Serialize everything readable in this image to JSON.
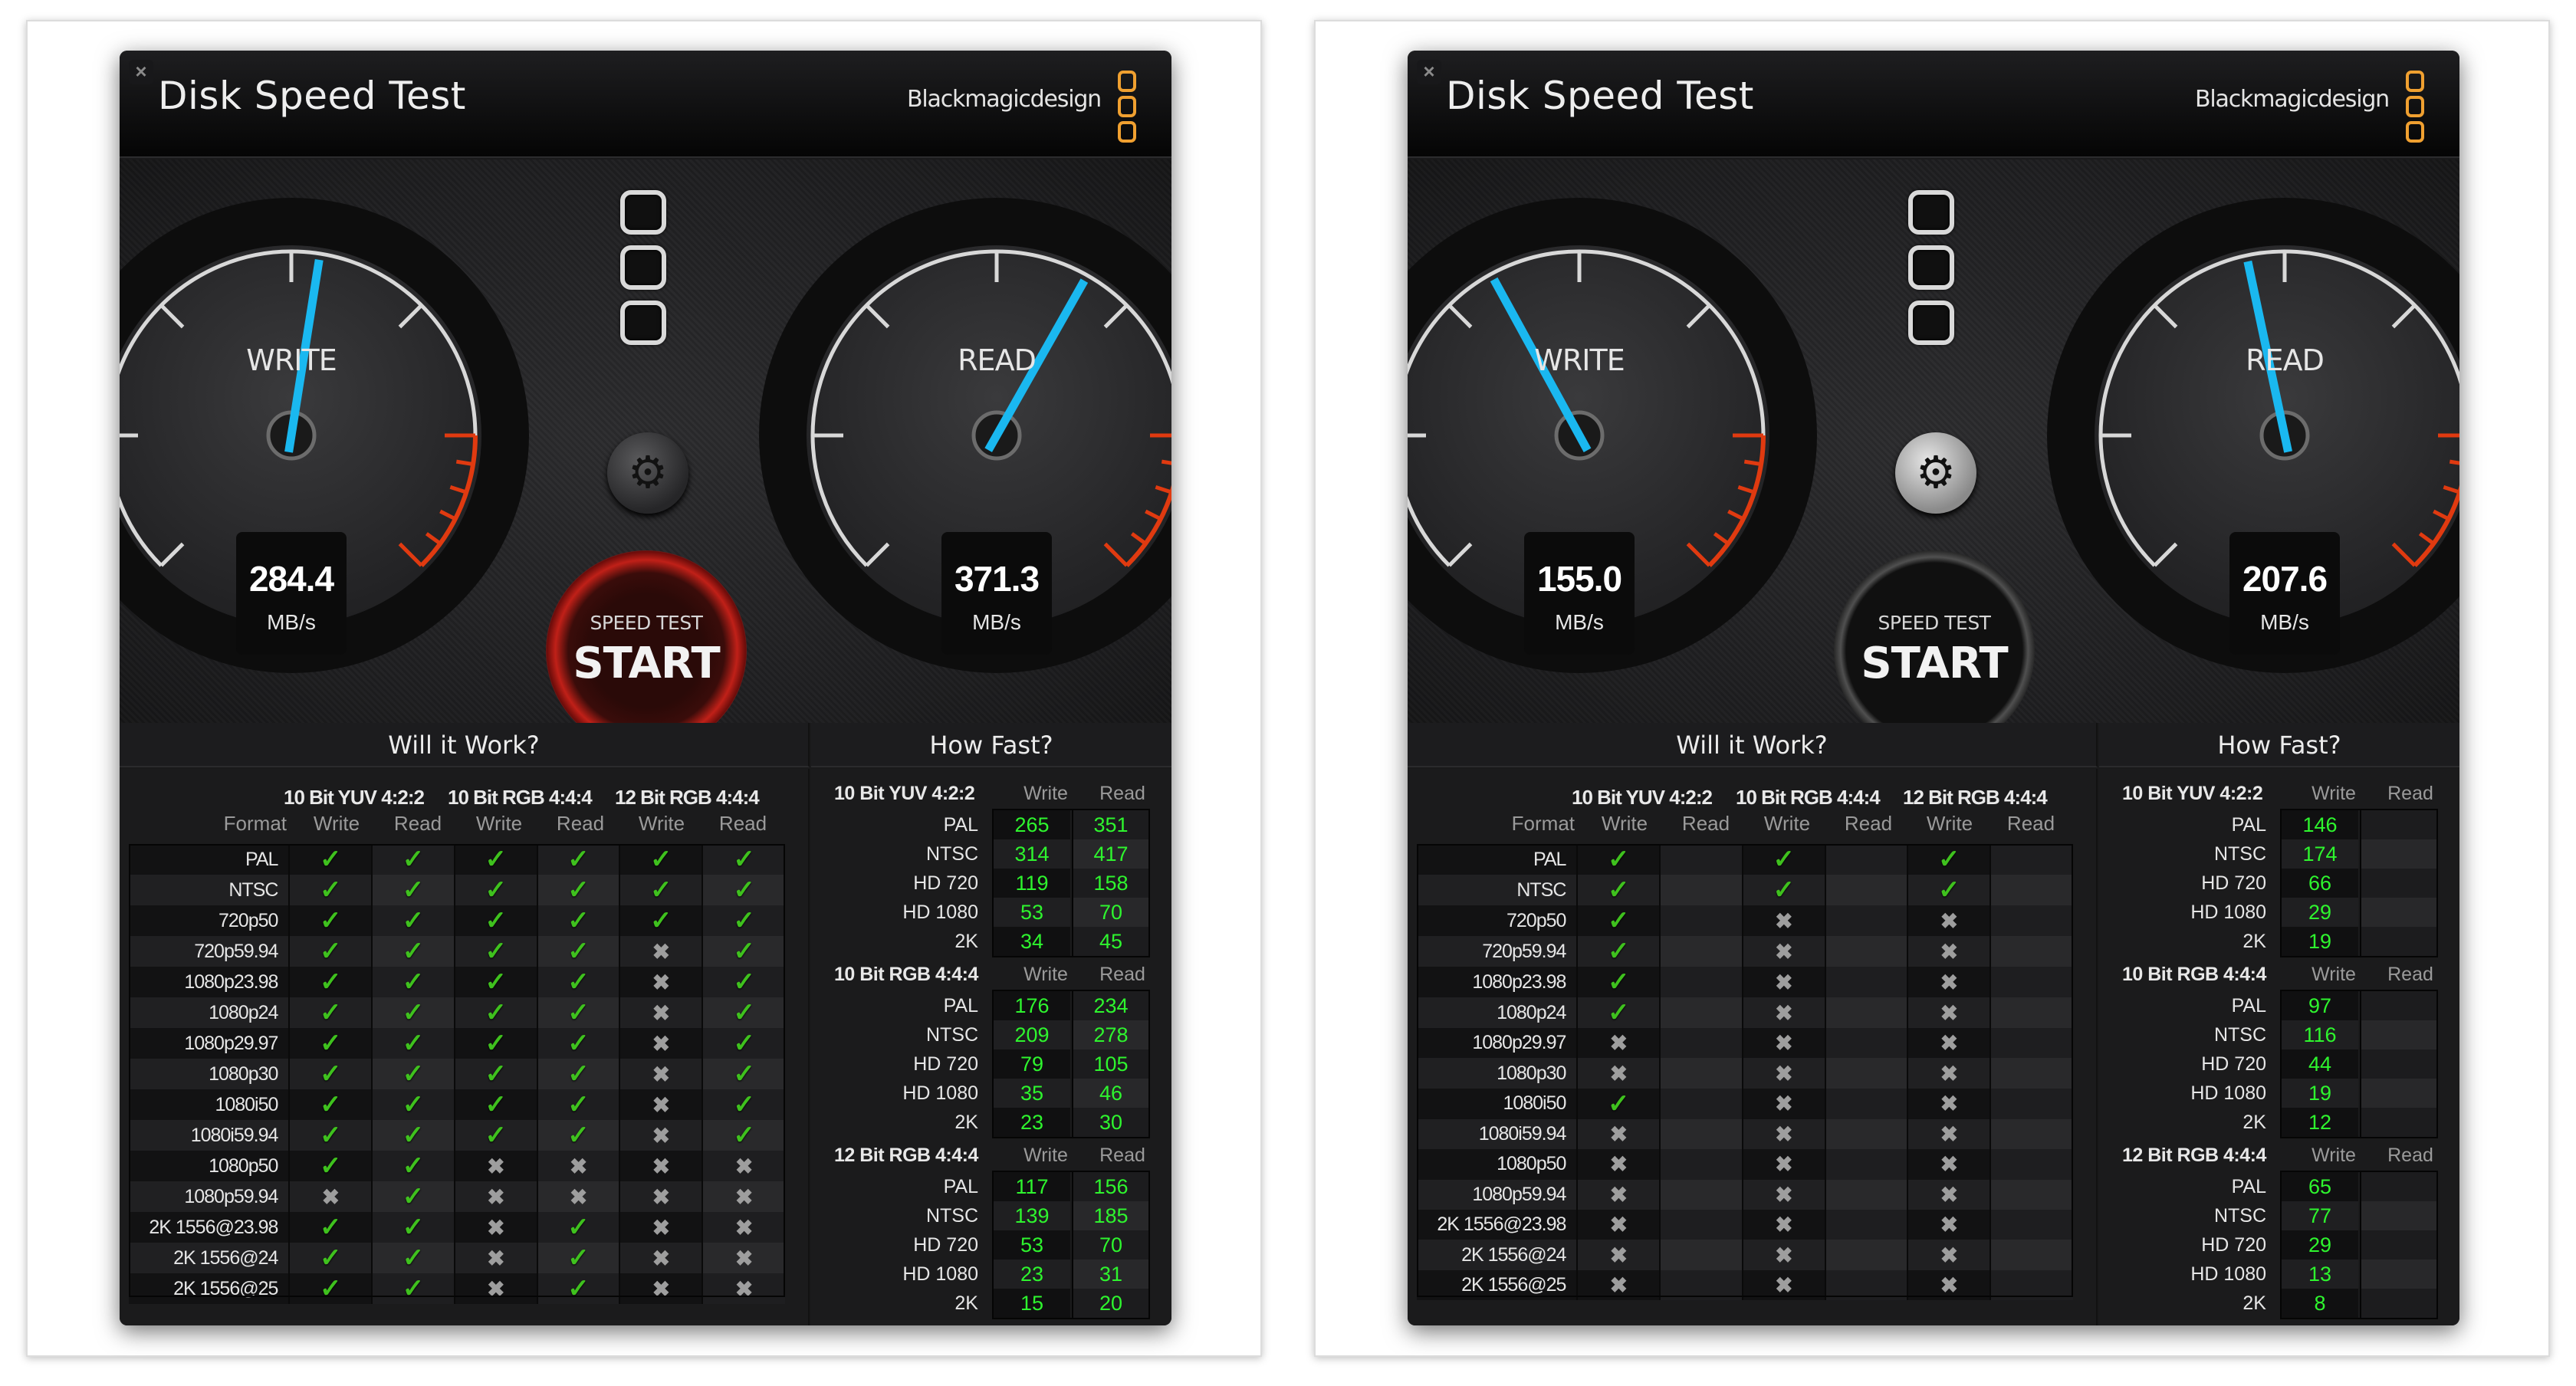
{
  "panels": [
    {
      "title": "Disk Speed Test",
      "brand": "Blackmagicdesign",
      "close_icon": "×",
      "gear_icon": "⚙",
      "active_gauge": "write",
      "write": {
        "label": "WRITE",
        "value": "284.4",
        "unit": "MB/s"
      },
      "read": {
        "label": "READ",
        "value": "371.3",
        "unit": "MB/s"
      },
      "start": {
        "small": "SPEED TEST",
        "big": "START"
      },
      "will_it_work": {
        "title": "Will it Work?",
        "groups": [
          "10 Bit YUV 4:2:2",
          "10 Bit RGB 4:4:4",
          "12 Bit RGB 4:4:4"
        ],
        "format_header": "Format",
        "write_header": "Write",
        "read_header": "Read",
        "rows": [
          {
            "format": "PAL",
            "cells": [
              "ok",
              "ok",
              "ok",
              "ok",
              "ok",
              "ok"
            ]
          },
          {
            "format": "NTSC",
            "cells": [
              "ok",
              "ok",
              "ok",
              "ok",
              "ok",
              "ok"
            ]
          },
          {
            "format": "720p50",
            "cells": [
              "ok",
              "ok",
              "ok",
              "ok",
              "ok",
              "ok"
            ]
          },
          {
            "format": "720p59.94",
            "cells": [
              "ok",
              "ok",
              "ok",
              "ok",
              "no",
              "ok"
            ]
          },
          {
            "format": "1080p23.98",
            "cells": [
              "ok",
              "ok",
              "ok",
              "ok",
              "no",
              "ok"
            ]
          },
          {
            "format": "1080p24",
            "cells": [
              "ok",
              "ok",
              "ok",
              "ok",
              "no",
              "ok"
            ]
          },
          {
            "format": "1080p29.97",
            "cells": [
              "ok",
              "ok",
              "ok",
              "ok",
              "no",
              "ok"
            ]
          },
          {
            "format": "1080p30",
            "cells": [
              "ok",
              "ok",
              "ok",
              "ok",
              "no",
              "ok"
            ]
          },
          {
            "format": "1080i50",
            "cells": [
              "ok",
              "ok",
              "ok",
              "ok",
              "no",
              "ok"
            ]
          },
          {
            "format": "1080i59.94",
            "cells": [
              "ok",
              "ok",
              "ok",
              "ok",
              "no",
              "ok"
            ]
          },
          {
            "format": "1080p50",
            "cells": [
              "ok",
              "ok",
              "no",
              "no",
              "no",
              "no"
            ]
          },
          {
            "format": "1080p59.94",
            "cells": [
              "no",
              "ok",
              "no",
              "no",
              "no",
              "no"
            ]
          },
          {
            "format": "2K 1556@23.98",
            "cells": [
              "ok",
              "ok",
              "no",
              "ok",
              "no",
              "no"
            ]
          },
          {
            "format": "2K 1556@24",
            "cells": [
              "ok",
              "ok",
              "no",
              "ok",
              "no",
              "no"
            ]
          },
          {
            "format": "2K 1556@25",
            "cells": [
              "ok",
              "ok",
              "no",
              "ok",
              "no",
              "no"
            ]
          }
        ]
      },
      "how_fast": {
        "title": "How Fast?",
        "write_header": "Write",
        "read_header": "Read",
        "groups": [
          {
            "name": "10 Bit YUV 4:2:2",
            "rows": [
              {
                "label": "PAL",
                "write": "265",
                "read": "351"
              },
              {
                "label": "NTSC",
                "write": "314",
                "read": "417"
              },
              {
                "label": "HD 720",
                "write": "119",
                "read": "158"
              },
              {
                "label": "HD 1080",
                "write": "53",
                "read": "70"
              },
              {
                "label": "2K",
                "write": "34",
                "read": "45"
              }
            ]
          },
          {
            "name": "10 Bit RGB 4:4:4",
            "rows": [
              {
                "label": "PAL",
                "write": "176",
                "read": "234"
              },
              {
                "label": "NTSC",
                "write": "209",
                "read": "278"
              },
              {
                "label": "HD 720",
                "write": "79",
                "read": "105"
              },
              {
                "label": "HD 1080",
                "write": "35",
                "read": "46"
              },
              {
                "label": "2K",
                "write": "23",
                "read": "30"
              }
            ]
          },
          {
            "name": "12 Bit RGB 4:4:4",
            "rows": [
              {
                "label": "PAL",
                "write": "117",
                "read": "156"
              },
              {
                "label": "NTSC",
                "write": "139",
                "read": "185"
              },
              {
                "label": "HD 720",
                "write": "53",
                "read": "70"
              },
              {
                "label": "HD 1080",
                "write": "23",
                "read": "31"
              },
              {
                "label": "2K",
                "write": "15",
                "read": "20"
              }
            ]
          }
        ]
      }
    },
    {
      "title": "Disk Speed Test",
      "brand": "Blackmagicdesign",
      "close_icon": "×",
      "gear_icon": "⚙",
      "active_gauge": "none",
      "write": {
        "label": "WRITE",
        "value": "155.0",
        "unit": "MB/s"
      },
      "read": {
        "label": "READ",
        "value": "207.6",
        "unit": "MB/s"
      },
      "start": {
        "small": "SPEED TEST",
        "big": "START"
      },
      "will_it_work": {
        "title": "Will it Work?",
        "groups": [
          "10 Bit YUV 4:2:2",
          "10 Bit RGB 4:4:4",
          "12 Bit RGB 4:4:4"
        ],
        "format_header": "Format",
        "write_header": "Write",
        "read_header": "Read",
        "rows": [
          {
            "format": "PAL",
            "cells": [
              "ok",
              "",
              "ok",
              "",
              "ok",
              ""
            ]
          },
          {
            "format": "NTSC",
            "cells": [
              "ok",
              "",
              "ok",
              "",
              "ok",
              ""
            ]
          },
          {
            "format": "720p50",
            "cells": [
              "ok",
              "",
              "no",
              "",
              "no",
              ""
            ]
          },
          {
            "format": "720p59.94",
            "cells": [
              "ok",
              "",
              "no",
              "",
              "no",
              ""
            ]
          },
          {
            "format": "1080p23.98",
            "cells": [
              "ok",
              "",
              "no",
              "",
              "no",
              ""
            ]
          },
          {
            "format": "1080p24",
            "cells": [
              "ok",
              "",
              "no",
              "",
              "no",
              ""
            ]
          },
          {
            "format": "1080p29.97",
            "cells": [
              "no",
              "",
              "no",
              "",
              "no",
              ""
            ]
          },
          {
            "format": "1080p30",
            "cells": [
              "no",
              "",
              "no",
              "",
              "no",
              ""
            ]
          },
          {
            "format": "1080i50",
            "cells": [
              "ok",
              "",
              "no",
              "",
              "no",
              ""
            ]
          },
          {
            "format": "1080i59.94",
            "cells": [
              "no",
              "",
              "no",
              "",
              "no",
              ""
            ]
          },
          {
            "format": "1080p50",
            "cells": [
              "no",
              "",
              "no",
              "",
              "no",
              ""
            ]
          },
          {
            "format": "1080p59.94",
            "cells": [
              "no",
              "",
              "no",
              "",
              "no",
              ""
            ]
          },
          {
            "format": "2K 1556@23.98",
            "cells": [
              "no",
              "",
              "no",
              "",
              "no",
              ""
            ]
          },
          {
            "format": "2K 1556@24",
            "cells": [
              "no",
              "",
              "no",
              "",
              "no",
              ""
            ]
          },
          {
            "format": "2K 1556@25",
            "cells": [
              "no",
              "",
              "no",
              "",
              "no",
              ""
            ]
          }
        ]
      },
      "how_fast": {
        "title": "How Fast?",
        "write_header": "Write",
        "read_header": "Read",
        "groups": [
          {
            "name": "10 Bit YUV 4:2:2",
            "rows": [
              {
                "label": "PAL",
                "write": "146",
                "read": ""
              },
              {
                "label": "NTSC",
                "write": "174",
                "read": ""
              },
              {
                "label": "HD 720",
                "write": "66",
                "read": ""
              },
              {
                "label": "HD 1080",
                "write": "29",
                "read": ""
              },
              {
                "label": "2K",
                "write": "19",
                "read": ""
              }
            ]
          },
          {
            "name": "10 Bit RGB 4:4:4",
            "rows": [
              {
                "label": "PAL",
                "write": "97",
                "read": ""
              },
              {
                "label": "NTSC",
                "write": "116",
                "read": ""
              },
              {
                "label": "HD 720",
                "write": "44",
                "read": ""
              },
              {
                "label": "HD 1080",
                "write": "19",
                "read": ""
              },
              {
                "label": "2K",
                "write": "12",
                "read": ""
              }
            ]
          },
          {
            "name": "12 Bit RGB 4:4:4",
            "rows": [
              {
                "label": "PAL",
                "write": "65",
                "read": ""
              },
              {
                "label": "NTSC",
                "write": "77",
                "read": ""
              },
              {
                "label": "HD 720",
                "write": "29",
                "read": ""
              },
              {
                "label": "HD 1080",
                "write": "13",
                "read": ""
              },
              {
                "label": "2K",
                "write": "8",
                "read": ""
              }
            ]
          }
        ]
      }
    }
  ],
  "gauge_scale": {
    "min": 0,
    "max": 1000,
    "unit": "MB/s"
  },
  "colors": {
    "needle": "#1ab8f0",
    "check": "#3fc11e",
    "speed_value": "#2ef52e",
    "brand_logo": "#f0a030",
    "redline": "#e03a10"
  },
  "icons": {
    "check": "✓",
    "cross": "✖"
  }
}
